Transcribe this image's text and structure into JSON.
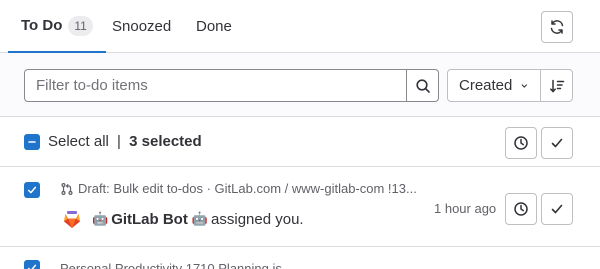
{
  "tabs": [
    {
      "label": "To Do",
      "count": "11"
    },
    {
      "label": "Snoozed"
    },
    {
      "label": "Done"
    }
  ],
  "filter": {
    "placeholder": "Filter to-do items",
    "sort_label": "Created"
  },
  "bulk": {
    "select_all_label": "Select all",
    "separator": "|",
    "selected_count": "3 selected"
  },
  "todos": [
    {
      "meta": "Draft: Bulk edit to-dos · GitLab.com / www-gitlab-com !13...",
      "author": "GitLab Bot",
      "action": "assigned you.",
      "bot_emoji": "🤖",
      "time": "1 hour ago",
      "checked": true
    },
    {
      "meta": "Personal Productivity 1710 Planning is",
      "checked": true
    }
  ],
  "icons": {
    "refresh": "refresh-icon",
    "search": "search-icon",
    "chevron": "chevron-down-icon",
    "sort": "sort-lowest-icon",
    "snooze": "clock-icon",
    "done": "check-icon",
    "merge_request": "merge-request-icon"
  },
  "colors": {
    "accent": "#1f75cb",
    "border": "#dcdcde",
    "muted_text": "#626168"
  }
}
